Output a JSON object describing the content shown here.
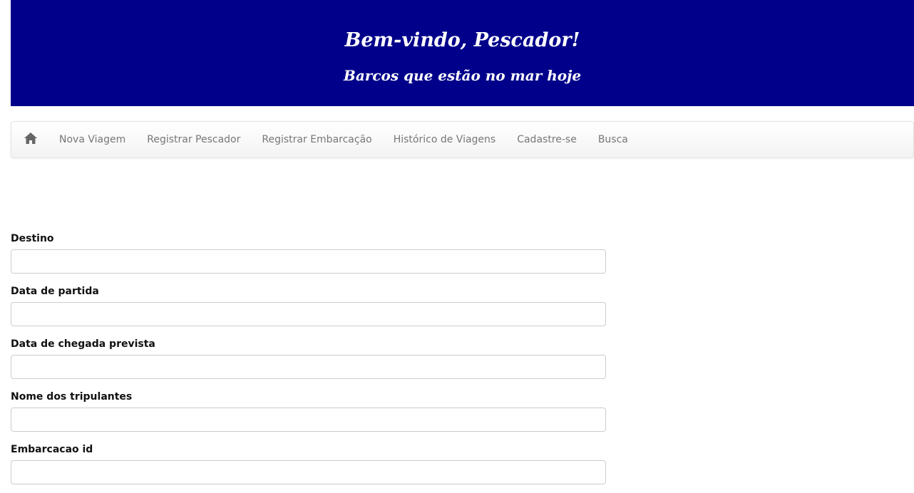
{
  "header": {
    "title": "Bem-vindo, Pescador!",
    "subtitle": "Barcos que estão no mar hoje",
    "background_color": "#00008b"
  },
  "navbar": {
    "home_icon": "home-icon",
    "items": [
      {
        "label": "Nova Viagem"
      },
      {
        "label": "Registrar Pescador"
      },
      {
        "label": "Registrar Embarcação"
      },
      {
        "label": "Histórico de Viagens"
      },
      {
        "label": "Cadastre-se"
      },
      {
        "label": "Busca"
      }
    ]
  },
  "form": {
    "fields": [
      {
        "label": "Destino",
        "value": "",
        "placeholder": ""
      },
      {
        "label": "Data de partida",
        "value": "",
        "placeholder": ""
      },
      {
        "label": "Data de chegada prevista",
        "value": "",
        "placeholder": ""
      },
      {
        "label": "Nome dos tripulantes",
        "value": "",
        "placeholder": ""
      },
      {
        "label": "Embarcacao id",
        "value": "",
        "placeholder": ""
      }
    ]
  }
}
